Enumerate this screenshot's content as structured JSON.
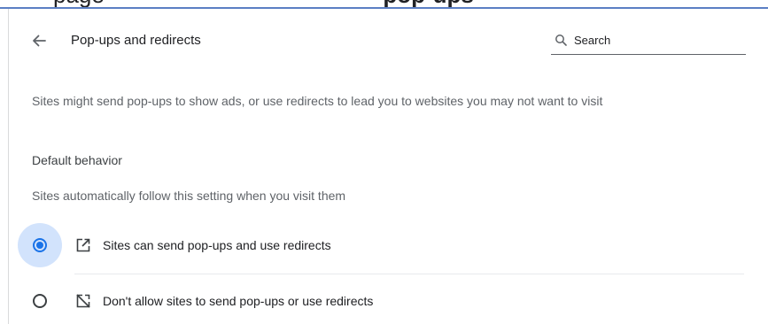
{
  "top_fragment": {
    "text_plain": "page",
    "text_bold": "pop-ups"
  },
  "header": {
    "title": "Pop-ups and redirects",
    "back_icon": "back-arrow-icon"
  },
  "search": {
    "placeholder": "Search",
    "value": "",
    "icon": "search-icon"
  },
  "description": "Sites might send pop-ups to show ads, or use redirects to lead you to websites you may not want to visit",
  "default_behavior": {
    "heading": "Default behavior",
    "subtext": "Sites automatically follow this setting when you visit them",
    "options": [
      {
        "label": "Sites can send pop-ups and use redirects",
        "selected": true,
        "icon": "open-in-new-icon"
      },
      {
        "label": "Don't allow sites to send pop-ups or use redirects",
        "selected": false,
        "icon": "popup-blocked-icon"
      }
    ]
  },
  "colors": {
    "accent": "#1a73e8",
    "halo": "#d2e3fc",
    "text_primary": "#202124",
    "text_secondary": "#5f6368"
  }
}
